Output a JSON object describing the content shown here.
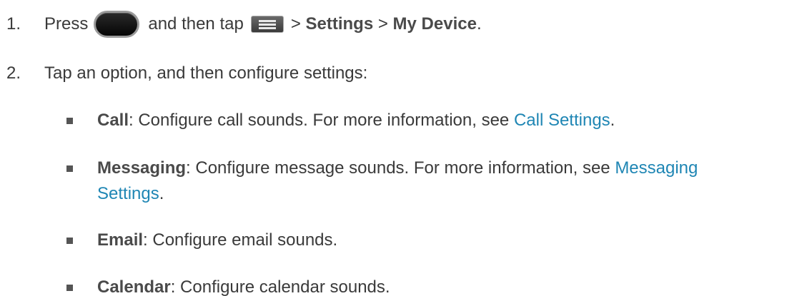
{
  "steps": [
    {
      "number": "1.",
      "press": "Press",
      "and_then_tap": "and then tap",
      "sep1": ">",
      "settings": "Settings",
      "sep2": ">",
      "my_device": "My Device",
      "end": ".",
      "home_key_icon": "home-key-icon",
      "menu_key_icon": "menu-key-icon"
    },
    {
      "number": "2.",
      "text": "Tap an option, and then configure settings:"
    }
  ],
  "options": [
    {
      "name": "Call",
      "desc": ": Configure call sounds. For more information, see ",
      "link": "Call Settings",
      "end": "."
    },
    {
      "name": "Messaging",
      "desc": ": Configure message sounds. For more information, see ",
      "link_line1": "Messaging",
      "link_line2": "Settings",
      "end": "."
    },
    {
      "name": "Email",
      "desc": ": Configure email sounds."
    },
    {
      "name": "Calendar",
      "desc": ": Configure calendar sounds."
    }
  ],
  "colors": {
    "text": "#3a3a3a",
    "link": "#1f86b4"
  }
}
